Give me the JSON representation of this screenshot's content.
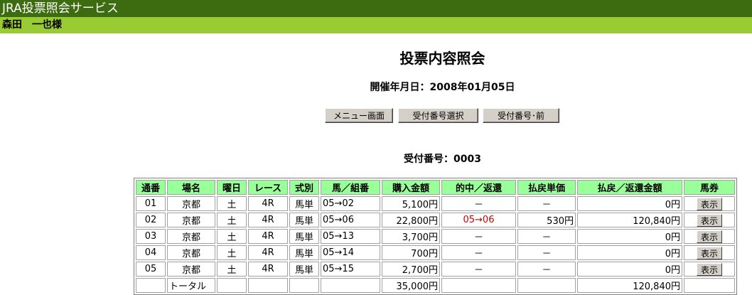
{
  "header": {
    "service_title": "JRA投票照会サービス",
    "user_name": "森田　一也様"
  },
  "main": {
    "title": "投票内容照会",
    "date_label": "開催年月日：",
    "date_value": "2008年01月05日",
    "buttons": {
      "menu": "メニュー画面",
      "select_receipt": "受付番号選択",
      "prev_receipt": "受付番号･前"
    },
    "receipt_label": "受付番号：",
    "receipt_value": "0003"
  },
  "table": {
    "headers": [
      "通番",
      "場名",
      "曜日",
      "レース",
      "式別",
      "馬／組番",
      "購入金額",
      "的中／返還",
      "払戻単価",
      "払戻／返還金額",
      "馬券"
    ],
    "rows": [
      {
        "no": "01",
        "venue": "京都",
        "day": "土",
        "race": "4R",
        "type": "馬単",
        "combo": "05→02",
        "amount": "5,100円",
        "hit": "－",
        "unit": "－",
        "payout": "0円",
        "ticket": "表示"
      },
      {
        "no": "02",
        "venue": "京都",
        "day": "土",
        "race": "4R",
        "type": "馬単",
        "combo": "05→06",
        "amount": "22,800円",
        "hit": "05→06",
        "unit": "530円",
        "payout": "120,840円",
        "ticket": "表示"
      },
      {
        "no": "03",
        "venue": "京都",
        "day": "土",
        "race": "4R",
        "type": "馬単",
        "combo": "05→13",
        "amount": "3,700円",
        "hit": "－",
        "unit": "－",
        "payout": "0円",
        "ticket": "表示"
      },
      {
        "no": "04",
        "venue": "京都",
        "day": "土",
        "race": "4R",
        "type": "馬単",
        "combo": "05→14",
        "amount": "700円",
        "hit": "－",
        "unit": "－",
        "payout": "0円",
        "ticket": "表示"
      },
      {
        "no": "05",
        "venue": "京都",
        "day": "土",
        "race": "4R",
        "type": "馬単",
        "combo": "05→15",
        "amount": "2,700円",
        "hit": "－",
        "unit": "－",
        "payout": "0円",
        "ticket": "表示"
      }
    ],
    "total": {
      "label": "トータル",
      "amount": "35,000円",
      "payout": "120,840円"
    }
  },
  "colors": {
    "topbar": "#3d6b0f",
    "userbar": "#99cc33",
    "header_cell": "#99ff99",
    "hit_text": "#cc0000"
  }
}
